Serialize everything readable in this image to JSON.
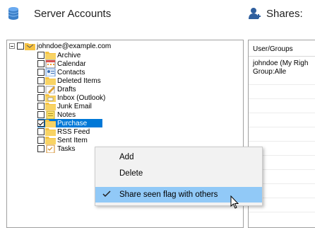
{
  "header": {
    "left_title": "Server Accounts",
    "right_title": "Shares:",
    "left_icon": "database-icon",
    "right_icon": "add-user-icon"
  },
  "tree": {
    "account": "johndoe@example.com",
    "items": [
      {
        "label": "Archive",
        "icon": "folder-icon",
        "checked": false
      },
      {
        "label": "Calendar",
        "icon": "calendar-icon",
        "checked": false
      },
      {
        "label": "Contacts",
        "icon": "contacts-icon",
        "checked": false
      },
      {
        "label": "Deleted Items",
        "icon": "folder-icon",
        "checked": false
      },
      {
        "label": "Drafts",
        "icon": "drafts-icon",
        "checked": false
      },
      {
        "label": "Inbox (Outlook)",
        "icon": "inbox-icon",
        "checked": false
      },
      {
        "label": "Junk Email",
        "icon": "folder-icon",
        "checked": false
      },
      {
        "label": "Notes",
        "icon": "notes-icon",
        "checked": false
      },
      {
        "label": "Purchase",
        "icon": "folder-icon",
        "checked": true,
        "selected": true
      },
      {
        "label": "RSS Feed",
        "icon": "folder-icon",
        "checked": false
      },
      {
        "label": "Sent Item",
        "icon": "folder-icon",
        "checked": false
      },
      {
        "label": "Tasks",
        "icon": "tasks-icon",
        "checked": false
      }
    ]
  },
  "shares": {
    "column_header": "User/Groups",
    "rows": [
      "johndoe (My Righ",
      "Group:Alle"
    ]
  },
  "context_menu": {
    "items": [
      {
        "label": "Add",
        "checked": false
      },
      {
        "label": "Delete",
        "checked": false
      },
      {
        "label": "Share seen flag with others",
        "checked": true,
        "highlighted": true
      }
    ]
  },
  "colors": {
    "selection": "#0078d7",
    "menu_highlight": "#91c9f7",
    "folder": "#f5c242"
  }
}
